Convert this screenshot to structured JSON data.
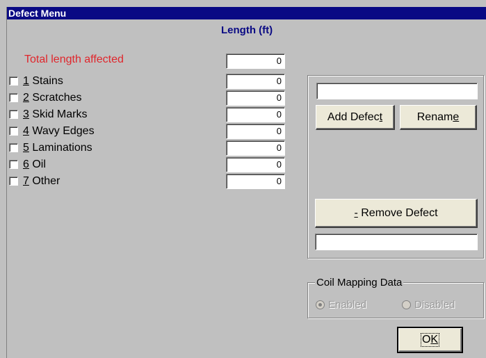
{
  "window": {
    "title": "Defect Menu"
  },
  "column_header": "Length (ft)",
  "total": {
    "label": "Total length affected",
    "value": "0"
  },
  "defects": [
    {
      "number": "1",
      "name": "Stains",
      "value": "0",
      "checked": false
    },
    {
      "number": "2",
      "name": "Scratches",
      "value": "0",
      "checked": false
    },
    {
      "number": "3",
      "name": "Skid Marks",
      "value": "0",
      "checked": false
    },
    {
      "number": "4",
      "name": "Wavy Edges",
      "value": "0",
      "checked": false
    },
    {
      "number": "5",
      "name": "Laminations",
      "value": "0",
      "checked": false
    },
    {
      "number": "6",
      "name": "Oil",
      "value": "0",
      "checked": false
    },
    {
      "number": "7",
      "name": "Other",
      "value": "0",
      "checked": false
    }
  ],
  "defect_editor": {
    "name_input_value": "",
    "add_button": {
      "before": "Add Defec",
      "mnemonic": "t",
      "after": ""
    },
    "rename_button": {
      "before": "Renam",
      "mnemonic": "e",
      "after": ""
    },
    "remove_button": {
      "before": "",
      "mnemonic": "-",
      "after": " Remove Defect"
    },
    "remove_input_value": ""
  },
  "coil_mapping": {
    "title": "Coil Mapping Data",
    "enabled_label": "Enabled",
    "disabled_label": "Disabled",
    "selected": "Enabled",
    "disabled_state": true
  },
  "ok_button": {
    "before": "O",
    "mnemonic": "K",
    "after": ""
  }
}
